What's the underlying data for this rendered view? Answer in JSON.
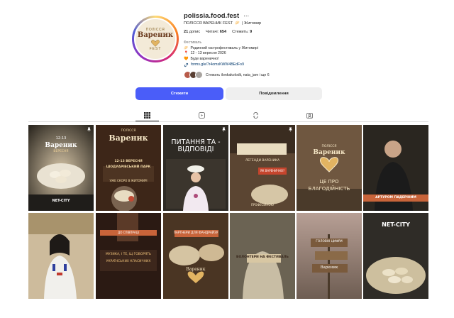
{
  "profile": {
    "username": "polissia.food.fest",
    "more_icon": "ellipsis-icon",
    "full_name": "ПОЛІССЯ ВАРЕНИК FEST",
    "location": "| Житомир",
    "avatar": {
      "line1": "ПОЛІССЯ",
      "line2": "Вареник",
      "line3": "FEST"
    },
    "stats": {
      "posts_count": "21",
      "posts_label": "допис",
      "followers_label": "Читачі:",
      "followers_count": "654",
      "following_label": "Стежить:",
      "following_count": "9"
    },
    "category": "Фестиваль",
    "bio_lines": [
      {
        "emoji": "🥟",
        "text": "Родинний гастрофестиваль у Житомирі"
      },
      {
        "emoji": "📍",
        "text": "12 - 13 вересня 2026"
      },
      {
        "emoji": "🧡",
        "text": "Буде вареничнo!"
      }
    ],
    "link_icon": "link-icon",
    "link": "forms.gle/7r4omsKWW4BEdFo9",
    "followed_by": "Стежать ilonkakolodii, nata_jam і ще 6"
  },
  "buttons": {
    "follow": "Стежити",
    "message": "Повідомлення"
  },
  "tabs": [
    {
      "name": "grid-icon",
      "active": true
    },
    {
      "name": "reels-icon",
      "active": false
    },
    {
      "name": "reposts-icon",
      "active": false
    },
    {
      "name": "tagged-icon",
      "active": false
    }
  ],
  "posts": [
    {
      "id": 1,
      "pinned": true,
      "top": "12-13",
      "title": "Вареник",
      "text": "ВЕРЕСНЯ",
      "footer": "NET-CITY"
    },
    {
      "id": 2,
      "pinned": false,
      "top": "ПОЛІССЯ",
      "title": "Вареник",
      "text": "12-13 ВЕРЕСНЯ",
      "text2": "ШОДУАРІВСЬКИЙ ПАРК",
      "text3": "УЖЕ СКОРО В ЖИТОМИРІ"
    },
    {
      "id": 3,
      "pinned": true,
      "title": "ПИТАННЯ ТА - ВІДПОВІДІ"
    },
    {
      "id": 4,
      "pinned": true,
      "text": "ЛЕГЕНДИ ВАРЕНИКА",
      "text2": "ЯК ВАРЕНИЧНО?",
      "text3": "ПРОФЕСІЙНОЮ"
    },
    {
      "id": 5,
      "pinned": false,
      "top": "ПОЛІССЯ",
      "title": "Вареник",
      "text": "ЦЕ ПРО",
      "text2": "БЛАГОДІЙНІСТЬ"
    },
    {
      "id": 6,
      "pinned": false,
      "text": "АРТУРОМ ПАДЕРІНИМ"
    },
    {
      "id": 7,
      "pinned": false
    },
    {
      "id": 8,
      "pinned": false,
      "text": "ДО СПІВПРАЦІ",
      "text2": "МУЗИКА, І ТЕ, Щ ГОВОРЯТЬ",
      "text3": "УКРАЇНСЬКИХ КЛАСИЧНИХ"
    },
    {
      "id": 9,
      "pinned": false,
      "text": "ПАРТНЕРИ ДЛЯ ФАНДРАЙЗУ",
      "text2": "Вареник"
    },
    {
      "id": 10,
      "pinned": false,
      "text": "ВОЛОНТЕРИ НА ФЕСТИВАЛЬ"
    },
    {
      "id": 11,
      "pinned": false,
      "text": "ГОЛОВНІ ЦИФРИ",
      "text2": "Вареник"
    },
    {
      "id": 12,
      "pinned": false,
      "text": "NET-CITY"
    }
  ],
  "colors": {
    "accent_button": "#4a5df9",
    "link": "#00376b",
    "brown_dark": "#3b2a1e",
    "cream": "#f3ead8"
  }
}
